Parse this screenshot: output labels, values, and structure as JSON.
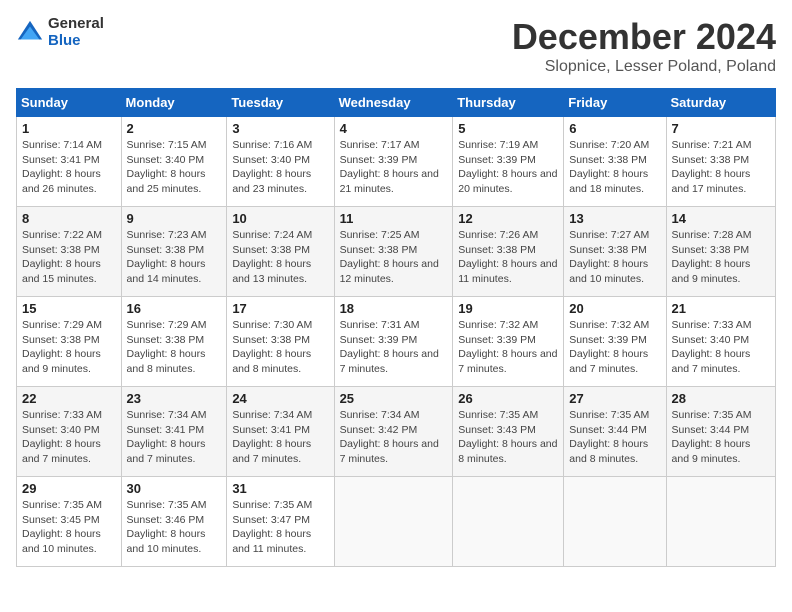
{
  "logo": {
    "general": "General",
    "blue": "Blue"
  },
  "title": "December 2024",
  "location": "Slopnice, Lesser Poland, Poland",
  "headers": [
    "Sunday",
    "Monday",
    "Tuesday",
    "Wednesday",
    "Thursday",
    "Friday",
    "Saturday"
  ],
  "weeks": [
    [
      {
        "day": "1",
        "sunrise": "Sunrise: 7:14 AM",
        "sunset": "Sunset: 3:41 PM",
        "daylight": "Daylight: 8 hours and 26 minutes."
      },
      {
        "day": "2",
        "sunrise": "Sunrise: 7:15 AM",
        "sunset": "Sunset: 3:40 PM",
        "daylight": "Daylight: 8 hours and 25 minutes."
      },
      {
        "day": "3",
        "sunrise": "Sunrise: 7:16 AM",
        "sunset": "Sunset: 3:40 PM",
        "daylight": "Daylight: 8 hours and 23 minutes."
      },
      {
        "day": "4",
        "sunrise": "Sunrise: 7:17 AM",
        "sunset": "Sunset: 3:39 PM",
        "daylight": "Daylight: 8 hours and 21 minutes."
      },
      {
        "day": "5",
        "sunrise": "Sunrise: 7:19 AM",
        "sunset": "Sunset: 3:39 PM",
        "daylight": "Daylight: 8 hours and 20 minutes."
      },
      {
        "day": "6",
        "sunrise": "Sunrise: 7:20 AM",
        "sunset": "Sunset: 3:38 PM",
        "daylight": "Daylight: 8 hours and 18 minutes."
      },
      {
        "day": "7",
        "sunrise": "Sunrise: 7:21 AM",
        "sunset": "Sunset: 3:38 PM",
        "daylight": "Daylight: 8 hours and 17 minutes."
      }
    ],
    [
      {
        "day": "8",
        "sunrise": "Sunrise: 7:22 AM",
        "sunset": "Sunset: 3:38 PM",
        "daylight": "Daylight: 8 hours and 15 minutes."
      },
      {
        "day": "9",
        "sunrise": "Sunrise: 7:23 AM",
        "sunset": "Sunset: 3:38 PM",
        "daylight": "Daylight: 8 hours and 14 minutes."
      },
      {
        "day": "10",
        "sunrise": "Sunrise: 7:24 AM",
        "sunset": "Sunset: 3:38 PM",
        "daylight": "Daylight: 8 hours and 13 minutes."
      },
      {
        "day": "11",
        "sunrise": "Sunrise: 7:25 AM",
        "sunset": "Sunset: 3:38 PM",
        "daylight": "Daylight: 8 hours and 12 minutes."
      },
      {
        "day": "12",
        "sunrise": "Sunrise: 7:26 AM",
        "sunset": "Sunset: 3:38 PM",
        "daylight": "Daylight: 8 hours and 11 minutes."
      },
      {
        "day": "13",
        "sunrise": "Sunrise: 7:27 AM",
        "sunset": "Sunset: 3:38 PM",
        "daylight": "Daylight: 8 hours and 10 minutes."
      },
      {
        "day": "14",
        "sunrise": "Sunrise: 7:28 AM",
        "sunset": "Sunset: 3:38 PM",
        "daylight": "Daylight: 8 hours and 9 minutes."
      }
    ],
    [
      {
        "day": "15",
        "sunrise": "Sunrise: 7:29 AM",
        "sunset": "Sunset: 3:38 PM",
        "daylight": "Daylight: 8 hours and 9 minutes."
      },
      {
        "day": "16",
        "sunrise": "Sunrise: 7:29 AM",
        "sunset": "Sunset: 3:38 PM",
        "daylight": "Daylight: 8 hours and 8 minutes."
      },
      {
        "day": "17",
        "sunrise": "Sunrise: 7:30 AM",
        "sunset": "Sunset: 3:38 PM",
        "daylight": "Daylight: 8 hours and 8 minutes."
      },
      {
        "day": "18",
        "sunrise": "Sunrise: 7:31 AM",
        "sunset": "Sunset: 3:39 PM",
        "daylight": "Daylight: 8 hours and 7 minutes."
      },
      {
        "day": "19",
        "sunrise": "Sunrise: 7:32 AM",
        "sunset": "Sunset: 3:39 PM",
        "daylight": "Daylight: 8 hours and 7 minutes."
      },
      {
        "day": "20",
        "sunrise": "Sunrise: 7:32 AM",
        "sunset": "Sunset: 3:39 PM",
        "daylight": "Daylight: 8 hours and 7 minutes."
      },
      {
        "day": "21",
        "sunrise": "Sunrise: 7:33 AM",
        "sunset": "Sunset: 3:40 PM",
        "daylight": "Daylight: 8 hours and 7 minutes."
      }
    ],
    [
      {
        "day": "22",
        "sunrise": "Sunrise: 7:33 AM",
        "sunset": "Sunset: 3:40 PM",
        "daylight": "Daylight: 8 hours and 7 minutes."
      },
      {
        "day": "23",
        "sunrise": "Sunrise: 7:34 AM",
        "sunset": "Sunset: 3:41 PM",
        "daylight": "Daylight: 8 hours and 7 minutes."
      },
      {
        "day": "24",
        "sunrise": "Sunrise: 7:34 AM",
        "sunset": "Sunset: 3:41 PM",
        "daylight": "Daylight: 8 hours and 7 minutes."
      },
      {
        "day": "25",
        "sunrise": "Sunrise: 7:34 AM",
        "sunset": "Sunset: 3:42 PM",
        "daylight": "Daylight: 8 hours and 7 minutes."
      },
      {
        "day": "26",
        "sunrise": "Sunrise: 7:35 AM",
        "sunset": "Sunset: 3:43 PM",
        "daylight": "Daylight: 8 hours and 8 minutes."
      },
      {
        "day": "27",
        "sunrise": "Sunrise: 7:35 AM",
        "sunset": "Sunset: 3:44 PM",
        "daylight": "Daylight: 8 hours and 8 minutes."
      },
      {
        "day": "28",
        "sunrise": "Sunrise: 7:35 AM",
        "sunset": "Sunset: 3:44 PM",
        "daylight": "Daylight: 8 hours and 9 minutes."
      }
    ],
    [
      {
        "day": "29",
        "sunrise": "Sunrise: 7:35 AM",
        "sunset": "Sunset: 3:45 PM",
        "daylight": "Daylight: 8 hours and 10 minutes."
      },
      {
        "day": "30",
        "sunrise": "Sunrise: 7:35 AM",
        "sunset": "Sunset: 3:46 PM",
        "daylight": "Daylight: 8 hours and 10 minutes."
      },
      {
        "day": "31",
        "sunrise": "Sunrise: 7:35 AM",
        "sunset": "Sunset: 3:47 PM",
        "daylight": "Daylight: 8 hours and 11 minutes."
      },
      null,
      null,
      null,
      null
    ]
  ]
}
